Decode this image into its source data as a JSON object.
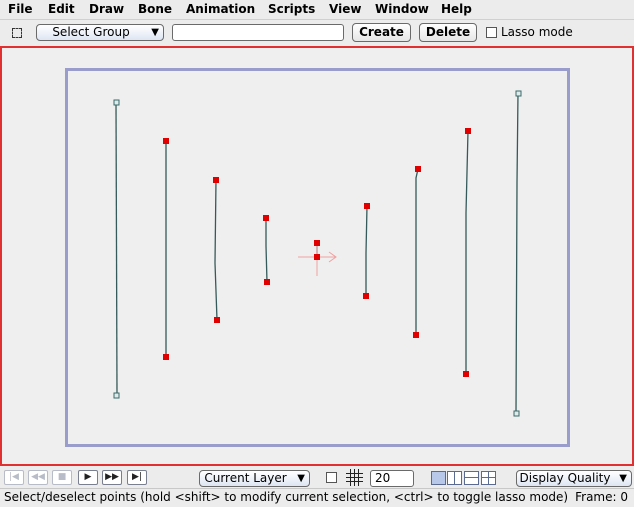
{
  "menu": [
    "File",
    "Edit",
    "Draw",
    "Bone",
    "Animation",
    "Scripts",
    "View",
    "Window",
    "Help"
  ],
  "toolbar": {
    "select_group_label": "Select Group",
    "group_name_value": "",
    "create_label": "Create",
    "delete_label": "Delete",
    "lasso_label": "Lasso mode",
    "lasso_checked": false
  },
  "playback": {
    "buttons": [
      "go-start",
      "step-back",
      "stop",
      "play",
      "step-forward",
      "go-end"
    ]
  },
  "layer_select": "Current Layer",
  "grid_size": "20",
  "display_quality": "Display Quality",
  "status": {
    "message": "Select/deselect points (hold <shift> to modify current selection, <ctrl> to toggle lasso mode)",
    "frame": "Frame: 0"
  },
  "colors": {
    "canvas_border": "#e03030",
    "frame_border": "#9a9ccc",
    "point_selected": "#e00000",
    "point_unselected": "#3a6a6a",
    "curve": "#355a5a"
  }
}
